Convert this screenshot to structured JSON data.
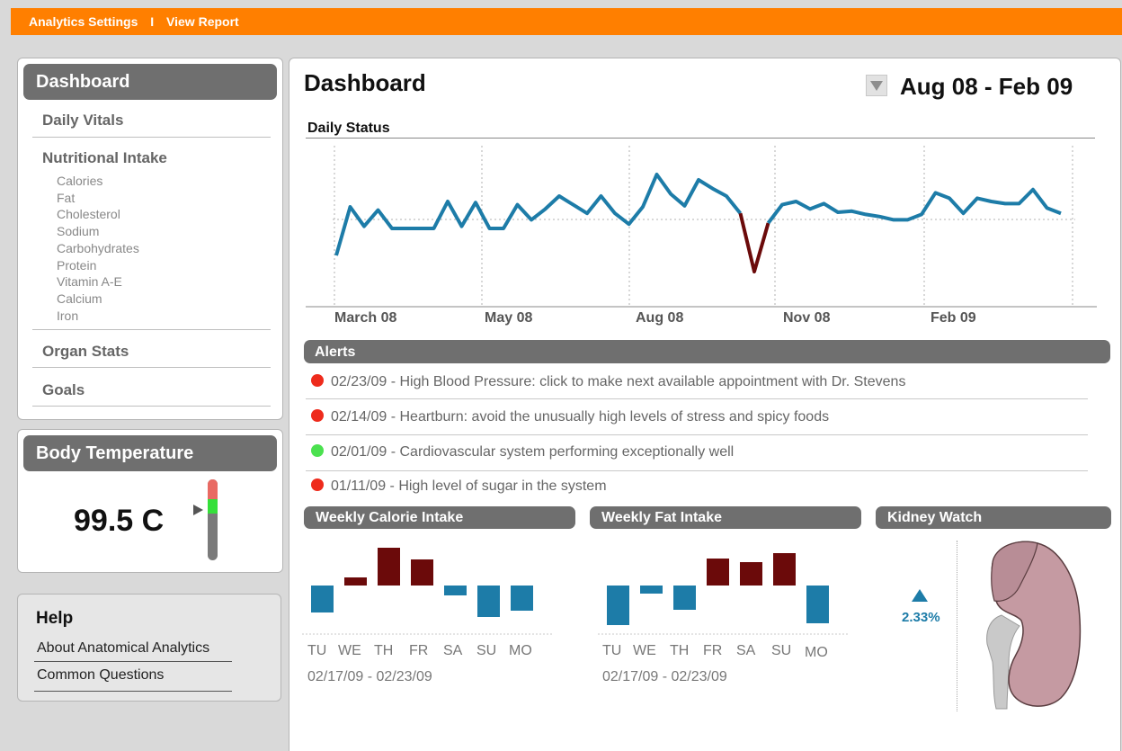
{
  "topbar": {
    "links": [
      "Analytics Settings",
      "View Report"
    ],
    "separator": "I"
  },
  "sidebar": {
    "title": "Dashboard",
    "sections": [
      {
        "label": "Daily Vitals"
      },
      {
        "label": "Nutritional Intake",
        "items": [
          "Calories",
          "Fat",
          "Cholesterol",
          "Sodium",
          "Carbohydrates",
          "Protein",
          "Vitamin A-E",
          "Calcium",
          "Iron"
        ]
      },
      {
        "label": "Organ Stats"
      },
      {
        "label": "Goals"
      }
    ]
  },
  "body_temperature": {
    "title": "Body Temperature",
    "value": "99.5 C",
    "colors": {
      "warning": "#e96a63",
      "normal": "#35e03a",
      "track": "#7a7a7a"
    }
  },
  "help": {
    "title": "Help",
    "links": [
      "About Anatomical Analytics",
      "Common Questions"
    ]
  },
  "main": {
    "title": "Dashboard",
    "date_range": "Aug 08 - Feb 09",
    "daily_status": {
      "title": "Daily Status",
      "months": [
        "March 08",
        "May 08",
        "Aug 08",
        "Nov 08",
        "Feb 09"
      ]
    },
    "alerts": {
      "title": "Alerts",
      "items": [
        {
          "text": "02/23/09 - High Blood Pressure: click to make next available appointment with Dr. Stevens",
          "status": "red"
        },
        {
          "text": "02/14/09 - Heartburn: avoid the unusually high levels of stress and spicy foods",
          "status": "red"
        },
        {
          "text": "02/01/09 - Cardiovascular system performing exceptionally well",
          "status": "green"
        },
        {
          "text": "01/11/09 - High level of sugar in the system",
          "status": "red"
        }
      ],
      "status_colors": {
        "red": "#ee2b1c",
        "green": "#4be14f"
      }
    },
    "weekly_calorie": {
      "title": "Weekly Calorie Intake",
      "days": [
        "TU",
        "WE",
        "TH",
        "FR",
        "SA",
        "SU",
        "MO"
      ],
      "range": "02/17/09 - 02/23/09"
    },
    "weekly_fat": {
      "title": "Weekly Fat Intake",
      "days": [
        "TU",
        "WE",
        "TH",
        "FR",
        "SA",
        "SU",
        "MO"
      ],
      "range": "02/17/09 - 02/23/09"
    },
    "kidney_watch": {
      "title": "Kidney Watch",
      "change": "2.33%",
      "trend": "up"
    }
  },
  "colors": {
    "accent": "#ff7f00",
    "pill": "#6f6f6f",
    "positive": "#1d7ca8",
    "negative": "#6b0a0a"
  },
  "chart_data": [
    {
      "type": "line",
      "title": "Daily Status",
      "x_ticks": [
        "March 08",
        "May 08",
        "Aug 08",
        "Nov 08",
        "Feb 09"
      ],
      "y_ticks": [],
      "values": [
        0.25,
        0.7,
        0.52,
        0.67,
        0.5,
        0.5,
        0.5,
        0.5,
        0.75,
        0.52,
        0.74,
        0.5,
        0.5,
        0.72,
        0.58,
        0.68,
        0.8,
        0.72,
        0.64,
        0.8,
        0.64,
        0.54,
        0.7,
        1.0,
        0.82,
        0.71,
        0.95,
        0.87,
        0.8,
        0.64,
        0.1,
        0.55,
        0.72,
        0.75,
        0.68,
        0.73,
        0.65,
        0.66,
        0.63,
        0.61,
        0.58,
        0.58,
        0.63,
        0.83,
        0.78,
        0.64,
        0.78,
        0.75,
        0.73,
        0.73,
        0.86,
        0.69,
        0.64
      ],
      "highlight_range": [
        29,
        31
      ],
      "series_color": "#1d7ca8",
      "highlight_color": "#6b0a0a"
    },
    {
      "type": "bar",
      "title": "Weekly Calorie Intake",
      "categories": [
        "TU",
        "WE",
        "TH",
        "FR",
        "SA",
        "SU",
        "MO"
      ],
      "values": [
        -30,
        9,
        42,
        29,
        -11,
        -35,
        -28
      ]
    },
    {
      "type": "bar",
      "title": "Weekly Fat Intake",
      "categories": [
        "TU",
        "WE",
        "TH",
        "FR",
        "SA",
        "SU",
        "MO"
      ],
      "values": [
        -44,
        -9,
        -27,
        30,
        26,
        36,
        -42
      ]
    }
  ]
}
